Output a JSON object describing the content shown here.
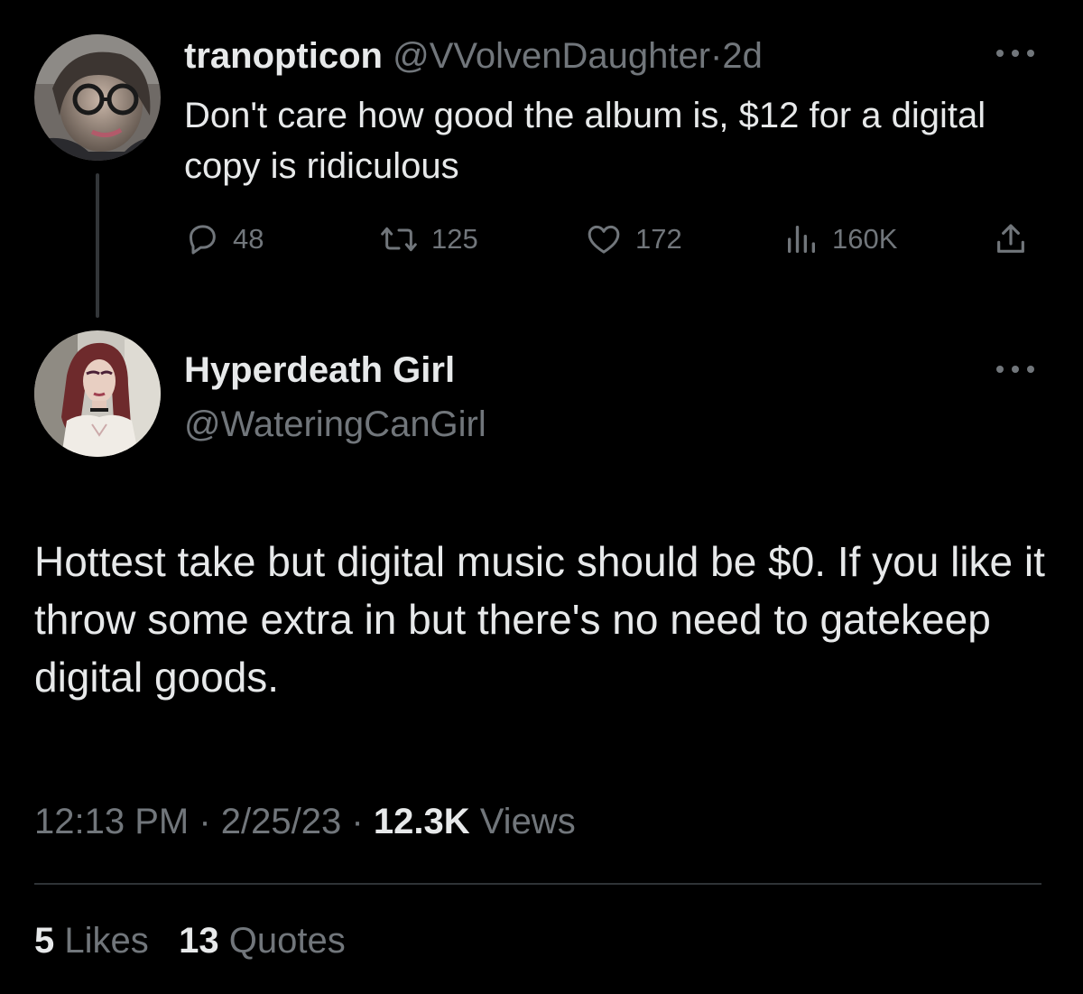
{
  "parent_tweet": {
    "author_name": "tranopticon",
    "author_handle": "@VVolvenDaughter",
    "separator": "·",
    "time_ago": "2d",
    "text": "Don't care how good the album is, $12 for a digital copy is ridiculous",
    "reply_count": "48",
    "retweet_count": "125",
    "like_count": "172",
    "view_count": "160K",
    "icons": {
      "reply": "reply-icon",
      "retweet": "retweet-icon",
      "like": "heart-icon",
      "views": "views-icon",
      "share": "share-icon",
      "more": "more-icon"
    }
  },
  "main_tweet": {
    "author_name": "Hyperdeath Girl",
    "author_handle": "@WateringCanGirl",
    "text": "Hottest take but digital music should be $0. If you like it throw some extra in but there's no need to gatekeep digital goods.",
    "time": "12:13 PM",
    "separator": "·",
    "date": "2/25/23",
    "views_count": "12.3K",
    "views_label": "Views",
    "likes_count": "5",
    "likes_label": "Likes",
    "quotes_count": "13",
    "quotes_label": "Quotes"
  },
  "colors": {
    "background": "#000000",
    "primary_text": "#e7e9ea",
    "secondary_text": "#71767b",
    "divider": "#2f3336",
    "thread_line": "#333639"
  }
}
